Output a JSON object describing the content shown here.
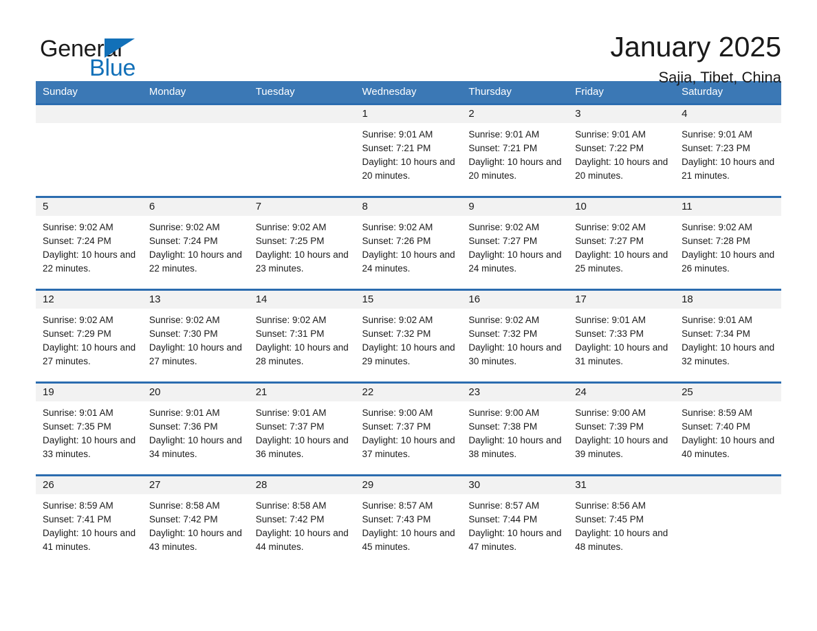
{
  "brand": {
    "name_part1": "General",
    "name_part2": "Blue",
    "triangle_color": "#1270b8",
    "blue_color": "#1270b8"
  },
  "header": {
    "title": "January 2025",
    "subtitle": "Sajia, Tibet, China"
  },
  "theme": {
    "header_bg": "#3b78b5",
    "week_rule": "#2b6caf",
    "daynum_bg": "#f2f2f2"
  },
  "weekdays": [
    "Sunday",
    "Monday",
    "Tuesday",
    "Wednesday",
    "Thursday",
    "Friday",
    "Saturday"
  ],
  "weeks": [
    [
      {
        "day": "",
        "sunrise": "",
        "sunset": "",
        "daylight": ""
      },
      {
        "day": "",
        "sunrise": "",
        "sunset": "",
        "daylight": ""
      },
      {
        "day": "",
        "sunrise": "",
        "sunset": "",
        "daylight": ""
      },
      {
        "day": "1",
        "sunrise": "Sunrise: 9:01 AM",
        "sunset": "Sunset: 7:21 PM",
        "daylight": "Daylight: 10 hours and 20 minutes."
      },
      {
        "day": "2",
        "sunrise": "Sunrise: 9:01 AM",
        "sunset": "Sunset: 7:21 PM",
        "daylight": "Daylight: 10 hours and 20 minutes."
      },
      {
        "day": "3",
        "sunrise": "Sunrise: 9:01 AM",
        "sunset": "Sunset: 7:22 PM",
        "daylight": "Daylight: 10 hours and 20 minutes."
      },
      {
        "day": "4",
        "sunrise": "Sunrise: 9:01 AM",
        "sunset": "Sunset: 7:23 PM",
        "daylight": "Daylight: 10 hours and 21 minutes."
      }
    ],
    [
      {
        "day": "5",
        "sunrise": "Sunrise: 9:02 AM",
        "sunset": "Sunset: 7:24 PM",
        "daylight": "Daylight: 10 hours and 22 minutes."
      },
      {
        "day": "6",
        "sunrise": "Sunrise: 9:02 AM",
        "sunset": "Sunset: 7:24 PM",
        "daylight": "Daylight: 10 hours and 22 minutes."
      },
      {
        "day": "7",
        "sunrise": "Sunrise: 9:02 AM",
        "sunset": "Sunset: 7:25 PM",
        "daylight": "Daylight: 10 hours and 23 minutes."
      },
      {
        "day": "8",
        "sunrise": "Sunrise: 9:02 AM",
        "sunset": "Sunset: 7:26 PM",
        "daylight": "Daylight: 10 hours and 24 minutes."
      },
      {
        "day": "9",
        "sunrise": "Sunrise: 9:02 AM",
        "sunset": "Sunset: 7:27 PM",
        "daylight": "Daylight: 10 hours and 24 minutes."
      },
      {
        "day": "10",
        "sunrise": "Sunrise: 9:02 AM",
        "sunset": "Sunset: 7:27 PM",
        "daylight": "Daylight: 10 hours and 25 minutes."
      },
      {
        "day": "11",
        "sunrise": "Sunrise: 9:02 AM",
        "sunset": "Sunset: 7:28 PM",
        "daylight": "Daylight: 10 hours and 26 minutes."
      }
    ],
    [
      {
        "day": "12",
        "sunrise": "Sunrise: 9:02 AM",
        "sunset": "Sunset: 7:29 PM",
        "daylight": "Daylight: 10 hours and 27 minutes."
      },
      {
        "day": "13",
        "sunrise": "Sunrise: 9:02 AM",
        "sunset": "Sunset: 7:30 PM",
        "daylight": "Daylight: 10 hours and 27 minutes."
      },
      {
        "day": "14",
        "sunrise": "Sunrise: 9:02 AM",
        "sunset": "Sunset: 7:31 PM",
        "daylight": "Daylight: 10 hours and 28 minutes."
      },
      {
        "day": "15",
        "sunrise": "Sunrise: 9:02 AM",
        "sunset": "Sunset: 7:32 PM",
        "daylight": "Daylight: 10 hours and 29 minutes."
      },
      {
        "day": "16",
        "sunrise": "Sunrise: 9:02 AM",
        "sunset": "Sunset: 7:32 PM",
        "daylight": "Daylight: 10 hours and 30 minutes."
      },
      {
        "day": "17",
        "sunrise": "Sunrise: 9:01 AM",
        "sunset": "Sunset: 7:33 PM",
        "daylight": "Daylight: 10 hours and 31 minutes."
      },
      {
        "day": "18",
        "sunrise": "Sunrise: 9:01 AM",
        "sunset": "Sunset: 7:34 PM",
        "daylight": "Daylight: 10 hours and 32 minutes."
      }
    ],
    [
      {
        "day": "19",
        "sunrise": "Sunrise: 9:01 AM",
        "sunset": "Sunset: 7:35 PM",
        "daylight": "Daylight: 10 hours and 33 minutes."
      },
      {
        "day": "20",
        "sunrise": "Sunrise: 9:01 AM",
        "sunset": "Sunset: 7:36 PM",
        "daylight": "Daylight: 10 hours and 34 minutes."
      },
      {
        "day": "21",
        "sunrise": "Sunrise: 9:01 AM",
        "sunset": "Sunset: 7:37 PM",
        "daylight": "Daylight: 10 hours and 36 minutes."
      },
      {
        "day": "22",
        "sunrise": "Sunrise: 9:00 AM",
        "sunset": "Sunset: 7:37 PM",
        "daylight": "Daylight: 10 hours and 37 minutes."
      },
      {
        "day": "23",
        "sunrise": "Sunrise: 9:00 AM",
        "sunset": "Sunset: 7:38 PM",
        "daylight": "Daylight: 10 hours and 38 minutes."
      },
      {
        "day": "24",
        "sunrise": "Sunrise: 9:00 AM",
        "sunset": "Sunset: 7:39 PM",
        "daylight": "Daylight: 10 hours and 39 minutes."
      },
      {
        "day": "25",
        "sunrise": "Sunrise: 8:59 AM",
        "sunset": "Sunset: 7:40 PM",
        "daylight": "Daylight: 10 hours and 40 minutes."
      }
    ],
    [
      {
        "day": "26",
        "sunrise": "Sunrise: 8:59 AM",
        "sunset": "Sunset: 7:41 PM",
        "daylight": "Daylight: 10 hours and 41 minutes."
      },
      {
        "day": "27",
        "sunrise": "Sunrise: 8:58 AM",
        "sunset": "Sunset: 7:42 PM",
        "daylight": "Daylight: 10 hours and 43 minutes."
      },
      {
        "day": "28",
        "sunrise": "Sunrise: 8:58 AM",
        "sunset": "Sunset: 7:42 PM",
        "daylight": "Daylight: 10 hours and 44 minutes."
      },
      {
        "day": "29",
        "sunrise": "Sunrise: 8:57 AM",
        "sunset": "Sunset: 7:43 PM",
        "daylight": "Daylight: 10 hours and 45 minutes."
      },
      {
        "day": "30",
        "sunrise": "Sunrise: 8:57 AM",
        "sunset": "Sunset: 7:44 PM",
        "daylight": "Daylight: 10 hours and 47 minutes."
      },
      {
        "day": "31",
        "sunrise": "Sunrise: 8:56 AM",
        "sunset": "Sunset: 7:45 PM",
        "daylight": "Daylight: 10 hours and 48 minutes."
      },
      {
        "day": "",
        "sunrise": "",
        "sunset": "",
        "daylight": ""
      }
    ]
  ]
}
